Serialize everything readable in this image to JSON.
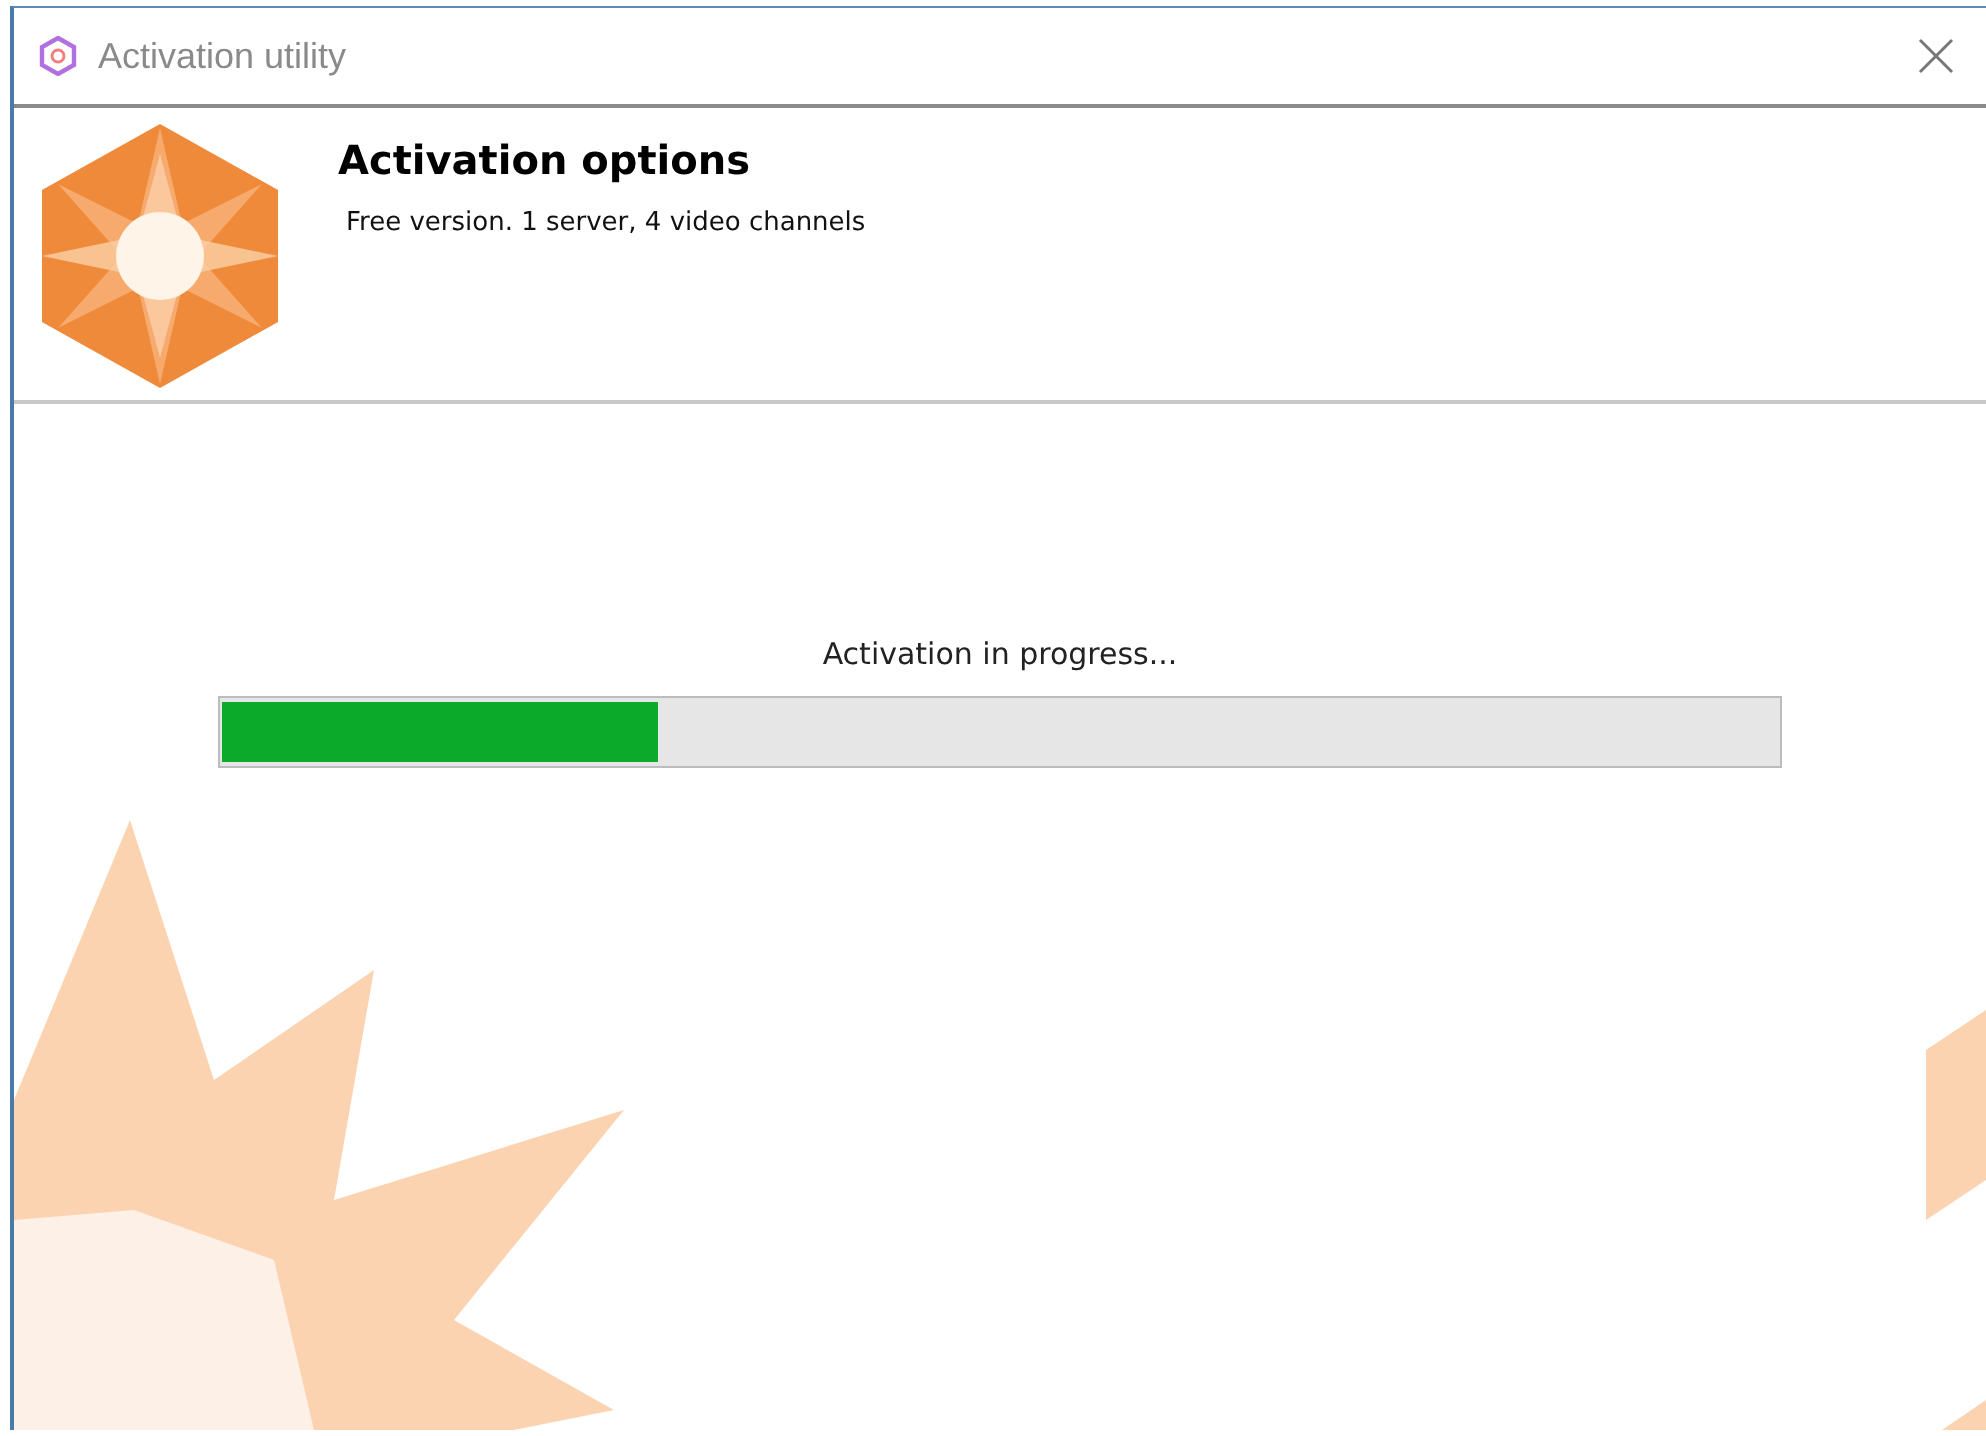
{
  "window": {
    "title": "Activation utility"
  },
  "header": {
    "title": "Activation options",
    "subtitle": "Free version. 1 server, 4 video channels"
  },
  "progress": {
    "label": "Activation in progress...",
    "level": 0.28
  }
}
